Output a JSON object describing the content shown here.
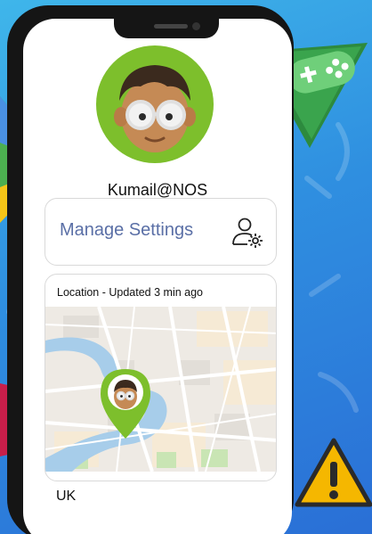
{
  "profile": {
    "username": "Kumail@NOS",
    "avatar_icon": "boy-with-glasses-avatar-icon"
  },
  "settings": {
    "label": "Manage Settings",
    "icon": "user-settings-icon"
  },
  "location": {
    "title": "Location - Updated 3 min ago",
    "country": "UK",
    "pin_icon": "location-pin-avatar-icon"
  },
  "colors": {
    "accent_green": "#7dbf2c",
    "settings_text": "#5a6fa6",
    "background_blue": "#2f8fe0"
  },
  "decorations": [
    "gamepad-icon",
    "play-store-icon",
    "video-icon",
    "warning-icon"
  ]
}
